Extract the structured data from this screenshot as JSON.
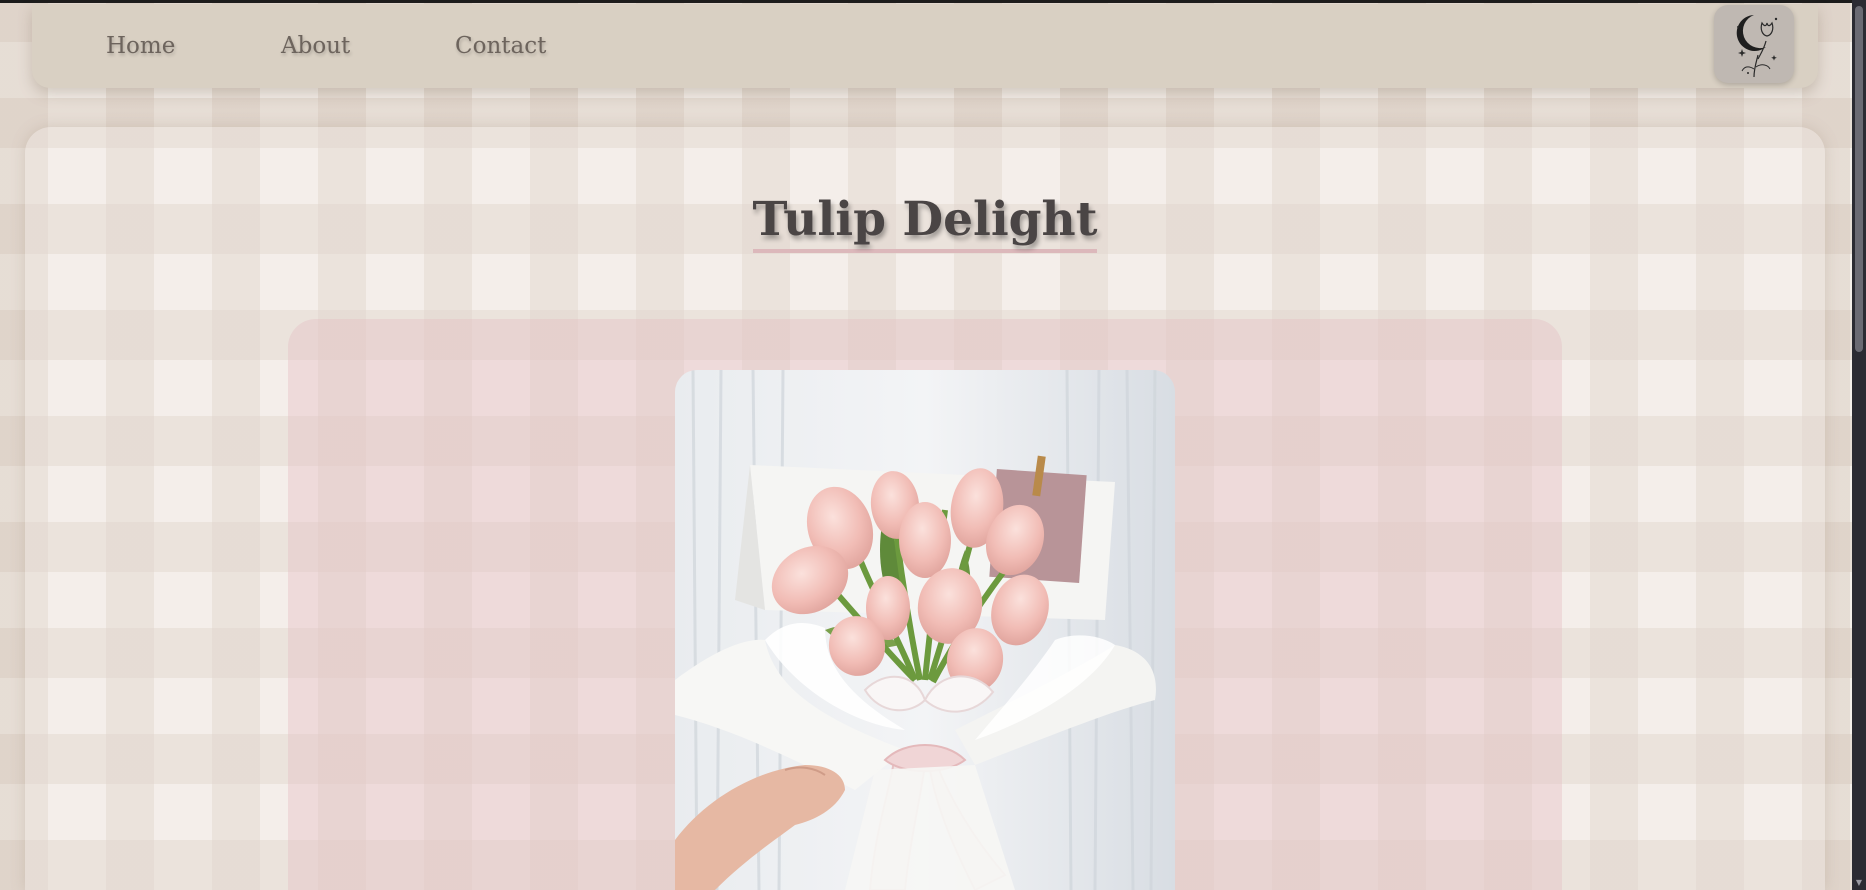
{
  "nav": {
    "items": [
      {
        "label": "Home"
      },
      {
        "label": "About"
      },
      {
        "label": "Contact"
      }
    ],
    "logo_icon": "moon-tulip-logo-icon"
  },
  "product": {
    "title": "Tulip Delight",
    "image_icon": "tulip-bouquet-image"
  },
  "colors": {
    "navbar": "#d9d0c3",
    "title_underline": "#dcb8bb",
    "panel": "#e8cdd1",
    "page_background": "#f4efea"
  }
}
